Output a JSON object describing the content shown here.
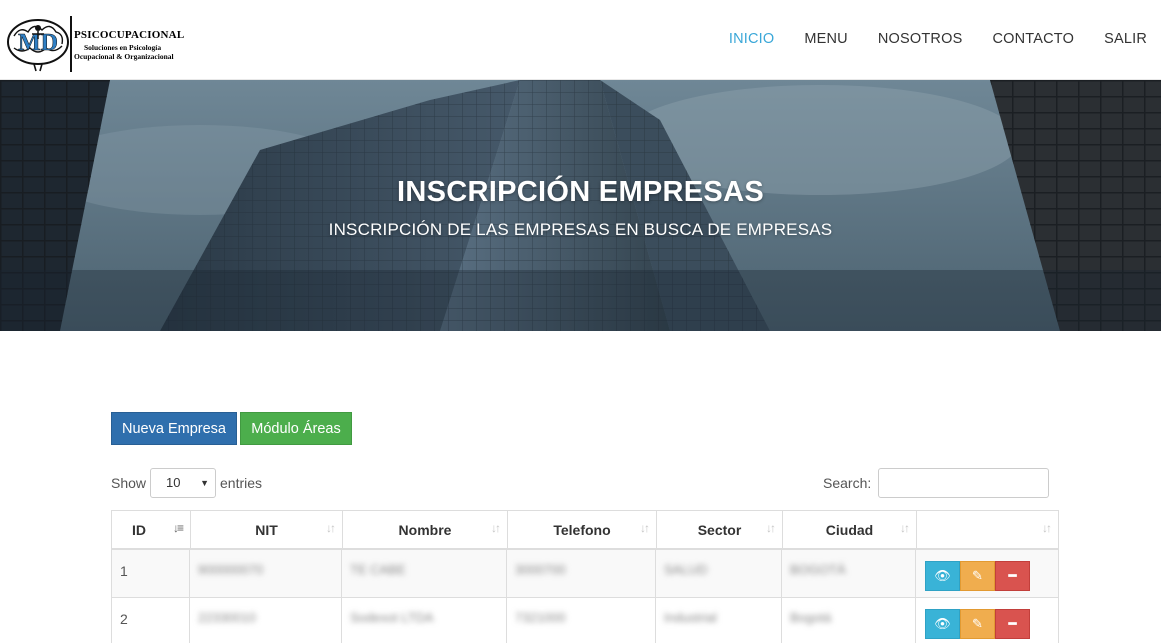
{
  "brand": {
    "name": "PSICOCUPACIONAL",
    "tagline_1": "Soluciones en Psicología",
    "tagline_2": "Ocupacional & Organizacional",
    "logo_letters": "MD"
  },
  "nav": {
    "items": [
      {
        "label": "INICIO",
        "active": true
      },
      {
        "label": "MENU",
        "active": false
      },
      {
        "label": "NOSOTROS",
        "active": false
      },
      {
        "label": "CONTACTO",
        "active": false
      },
      {
        "label": "SALIR",
        "active": false
      }
    ]
  },
  "hero": {
    "title": "INSCRIPCIÓN EMPRESAS",
    "subtitle": "INSCRIPCIÓN DE LAS EMPRESAS EN BUSCA DE EMPRESAS"
  },
  "buttons": {
    "new_company": "Nueva Empresa",
    "areas_module": "Módulo Áreas"
  },
  "table_controls": {
    "show_label": "Show",
    "entries_value": "10",
    "entries_label": "entries",
    "search_label": "Search:",
    "search_value": ""
  },
  "table": {
    "columns": [
      {
        "label": "ID",
        "sorted": true
      },
      {
        "label": "NIT",
        "sorted": false
      },
      {
        "label": "Nombre",
        "sorted": false
      },
      {
        "label": "Telefono",
        "sorted": false
      },
      {
        "label": "Sector",
        "sorted": false
      },
      {
        "label": "Ciudad",
        "sorted": false
      },
      {
        "label": "",
        "sorted": false
      }
    ],
    "rows": [
      {
        "id": "1",
        "nit": "900000070",
        "nombre": "TE CABE",
        "telefono": "3000700",
        "sector": "SALUD",
        "ciudad": "BOGOTÁ"
      },
      {
        "id": "2",
        "nit": "22330010",
        "nombre": "Sodexot LTDA",
        "telefono": "7321000",
        "sector": "Industrial",
        "ciudad": "Bogotá"
      }
    ]
  },
  "colors": {
    "accent": "#3aa7d8",
    "primary_button": "#2f6fad",
    "success_button": "#4cae4c",
    "info_button": "#39b3d7",
    "warning_button": "#f0ad4e",
    "danger_button": "#d9534f"
  }
}
